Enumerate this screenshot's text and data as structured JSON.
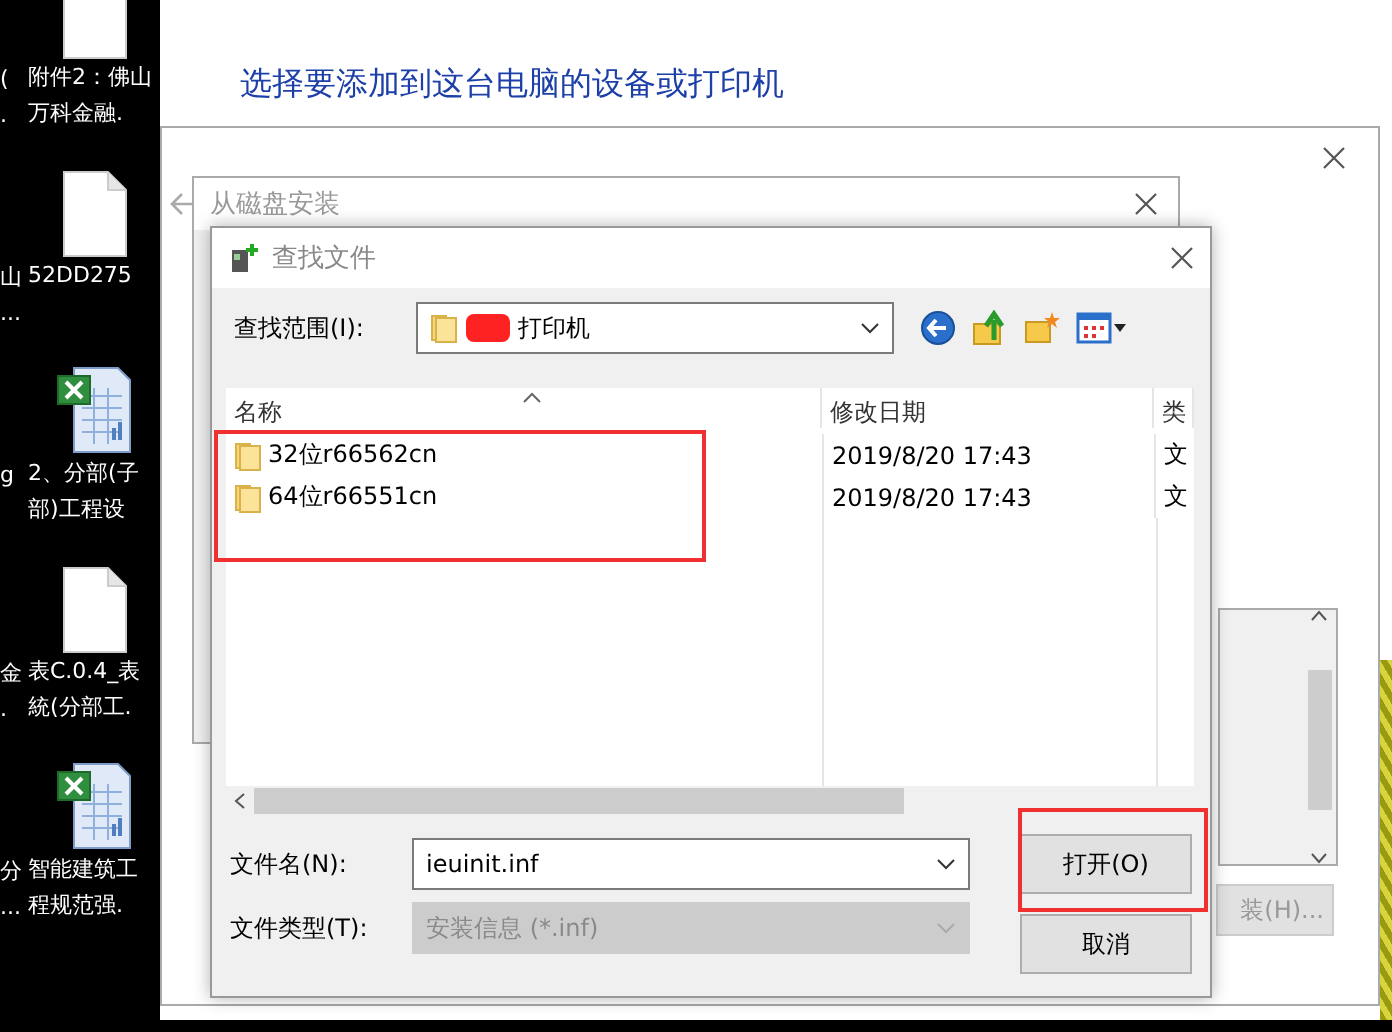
{
  "desktop": {
    "icons": [
      {
        "kind": "document",
        "lines": [
          "附件2：佛山",
          "万科金融."
        ],
        "fragment": [
          "(",
          "."
        ]
      },
      {
        "kind": "document",
        "lines": [
          "52DD275"
        ],
        "fragment": [
          "山",
          "..."
        ]
      },
      {
        "kind": "spreadsheet",
        "lines": [
          "2、分部(子",
          "部)工程设"
        ],
        "fragment": [
          "g"
        ]
      },
      {
        "kind": "document",
        "lines": [
          "表C.0.4_表",
          "統(分部工."
        ],
        "fragment": [
          "金",
          "."
        ]
      },
      {
        "kind": "spreadsheet",
        "lines": [
          "智能建筑工",
          "程规范强."
        ],
        "fragment": [
          "分",
          "..."
        ]
      }
    ]
  },
  "background_window": {
    "heading": "选择要添加到这台电脑的设备或打印机"
  },
  "printer_dialog": {
    "button": "装(H)..."
  },
  "disk_window": {
    "title": "从磁盘安装"
  },
  "find_dialog": {
    "title": "查找文件",
    "look_in": {
      "label": "查找范围(I):",
      "value": "打印机"
    },
    "columns": [
      {
        "label": "名称",
        "sorted": true
      },
      {
        "label": "修改日期",
        "sorted": false
      },
      {
        "label": "类",
        "sorted": false
      }
    ],
    "rows": [
      {
        "name": "32位r66562cn",
        "date": "2019/8/20 17:43",
        "type": "文"
      },
      {
        "name": "64位r66551cn",
        "date": "2019/8/20 17:43",
        "type": "文"
      }
    ],
    "file_name": {
      "label": "文件名(N):",
      "value": "ieuinit.inf"
    },
    "file_type": {
      "label": "文件类型(T):",
      "value": "安装信息 (*.inf)",
      "disabled": true
    },
    "buttons": [
      {
        "label": "打开(O)"
      },
      {
        "label": "取消"
      }
    ]
  }
}
